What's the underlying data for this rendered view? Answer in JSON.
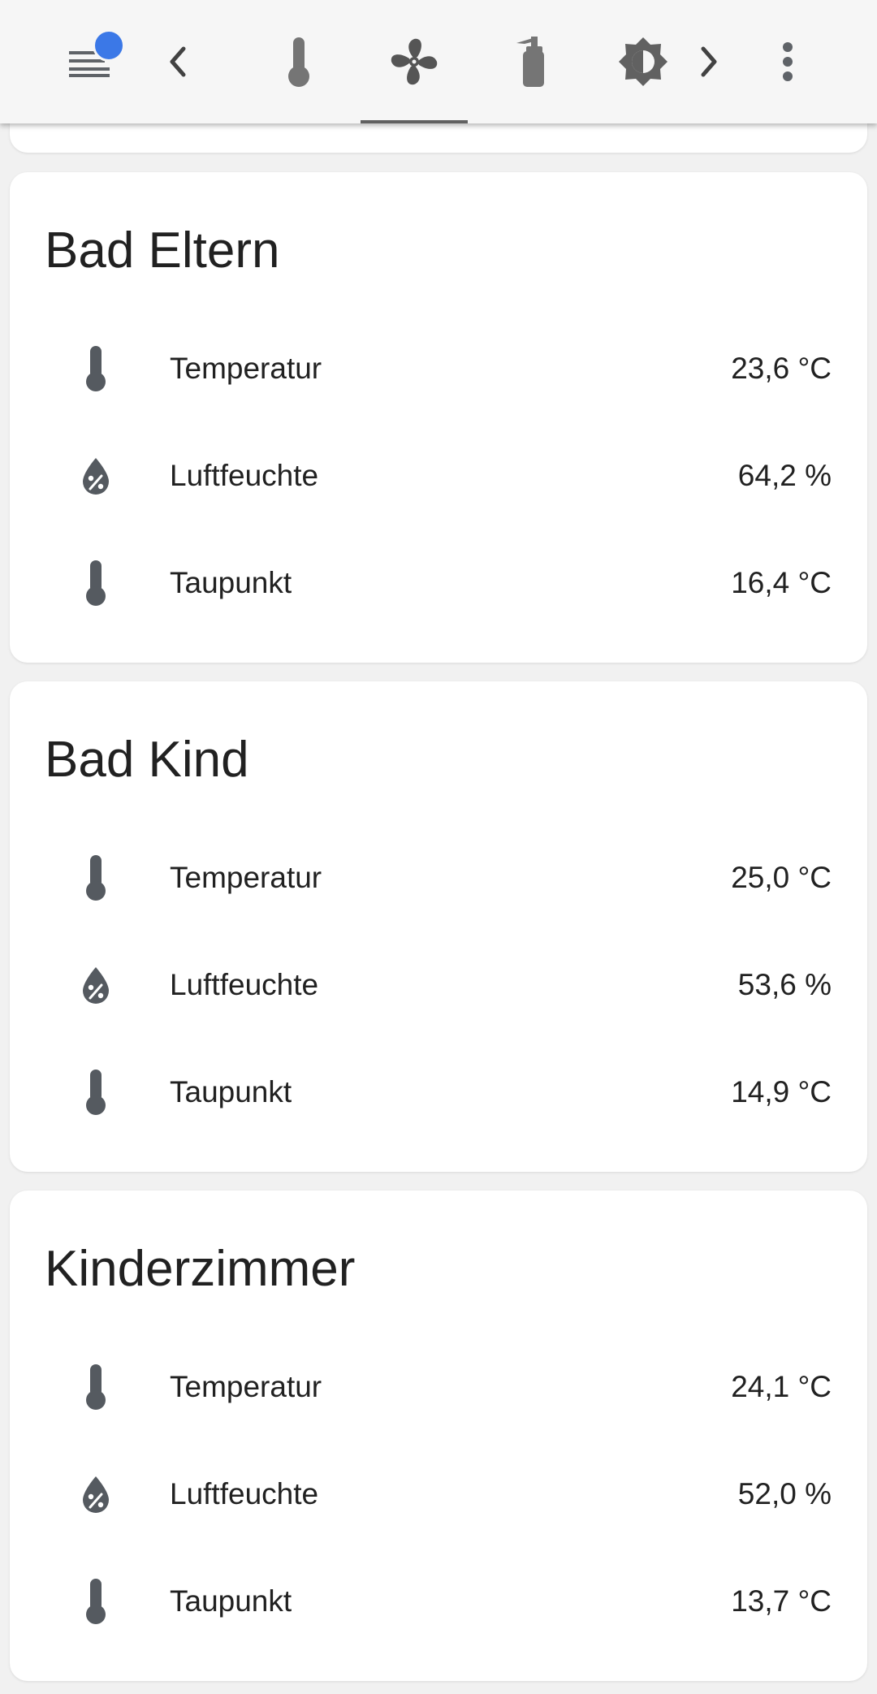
{
  "toolbar": {
    "menu_icon": "menu-icon",
    "badge_color": "#3b78e7",
    "prev_icon": "chevron-left-icon",
    "tabs": [
      {
        "icon": "thermometer-icon",
        "active": false
      },
      {
        "icon": "fan-icon",
        "active": true
      },
      {
        "icon": "fire-extinguisher-icon",
        "active": false
      },
      {
        "icon": "brightness-icon",
        "active": false
      }
    ],
    "next_icon": "chevron-right-icon",
    "overflow_icon": "dots-vertical-icon"
  },
  "cards": [
    {
      "title": "Bad Eltern",
      "rows": [
        {
          "icon": "thermometer-icon",
          "label": "Temperatur",
          "value": "23,6 °C"
        },
        {
          "icon": "water-percent-icon",
          "label": "Luftfeuchte",
          "value": "64,2 %"
        },
        {
          "icon": "thermometer-icon",
          "label": "Taupunkt",
          "value": "16,4 °C"
        }
      ]
    },
    {
      "title": "Bad Kind",
      "rows": [
        {
          "icon": "thermometer-icon",
          "label": "Temperatur",
          "value": "25,0 °C"
        },
        {
          "icon": "water-percent-icon",
          "label": "Luftfeuchte",
          "value": "53,6 %"
        },
        {
          "icon": "thermometer-icon",
          "label": "Taupunkt",
          "value": "14,9 °C"
        }
      ]
    },
    {
      "title": "Kinderzimmer",
      "rows": [
        {
          "icon": "thermometer-icon",
          "label": "Temperatur",
          "value": "24,1 °C"
        },
        {
          "icon": "water-percent-icon",
          "label": "Luftfeuchte",
          "value": "52,0 %"
        },
        {
          "icon": "thermometer-icon",
          "label": "Taupunkt",
          "value": "13,7 °C"
        }
      ]
    }
  ]
}
